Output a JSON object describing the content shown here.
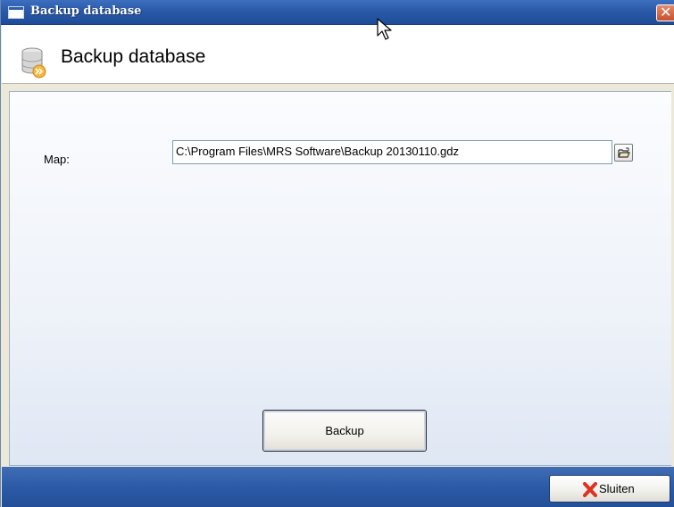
{
  "window": {
    "title": "Backup database"
  },
  "header": {
    "heading": "Backup database",
    "icon": "database-backup-icon"
  },
  "form": {
    "map_label": "Map:",
    "path_value": "C:\\Program Files\\MRS Software\\Backup 20130110.gdz",
    "browse_icon": "folder-open-icon"
  },
  "actions": {
    "backup_label": "Backup",
    "close_label": "Sluiten",
    "close_icon": "red-x-icon"
  },
  "colors": {
    "titlebar": "#2a5aa8",
    "footer": "#2c5aa6",
    "panel_bg": "#eef2f9",
    "close_x": "#e0301e"
  }
}
